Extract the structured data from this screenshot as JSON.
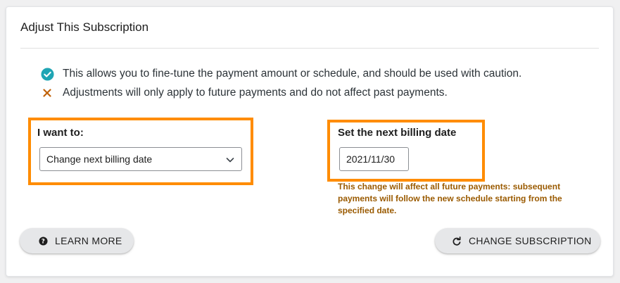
{
  "card": {
    "title": "Adjust This Subscription"
  },
  "notes": [
    {
      "icon": "check-circle-icon",
      "text": "This allows you to fine-tune the payment amount or schedule, and should be used with caution."
    },
    {
      "icon": "x-mark-icon",
      "text": "Adjustments will only apply to future payments and do not affect past payments."
    }
  ],
  "form": {
    "want_label": "I want to:",
    "want_selected": "Change next billing date",
    "date_label": "Set the next billing date",
    "date_value": "2021/11/30",
    "warning": "This change will affect all future payments: subsequent payments will follow the new schedule starting from the specified date."
  },
  "buttons": {
    "learn_more": "LEARN MORE",
    "change_subscription": "CHANGE SUBSCRIPTION"
  },
  "colors": {
    "highlight": "#ff8c00",
    "check": "#1fa5b4",
    "x_mark": "#c0620a",
    "warning_text": "#9a5a00"
  }
}
